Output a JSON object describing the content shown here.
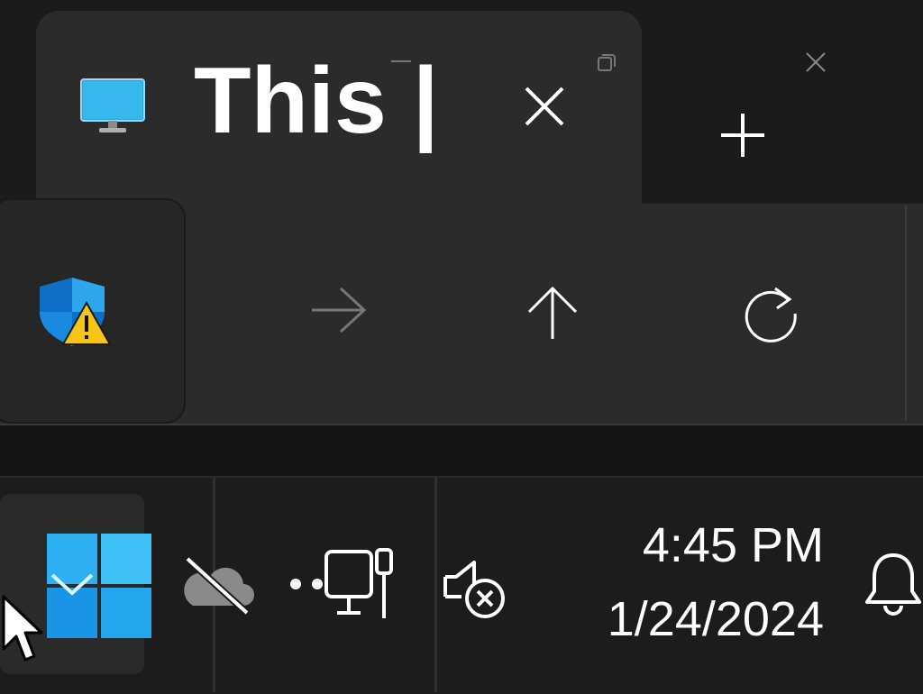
{
  "window": {
    "tab_title": "This |",
    "tab_icon": "monitor-icon",
    "close_tab_icon": "close-icon",
    "new_tab_icon": "plus-icon",
    "caption_buttons": [
      "minimize-icon",
      "restore-icon",
      "close-icon"
    ]
  },
  "toolbar": {
    "security_icon": "shield-warning-icon",
    "forward_icon": "arrow-right-icon",
    "up_icon": "arrow-up-icon",
    "refresh_icon": "refresh-icon"
  },
  "taskbar": {
    "start_icon": "windows-logo-icon",
    "tray_icons": [
      "onedrive-off-icon",
      "network-wired-icon",
      "speaker-muted-icon"
    ],
    "clock": {
      "time": "4:45 PM",
      "date": "1/24/2024"
    },
    "notification_icon": "bell-icon"
  },
  "colors": {
    "accent_blue": "#1ea8f0",
    "warning_yellow": "#f5c518",
    "background": "#1c1c1c",
    "surface": "#2b2b2b"
  }
}
